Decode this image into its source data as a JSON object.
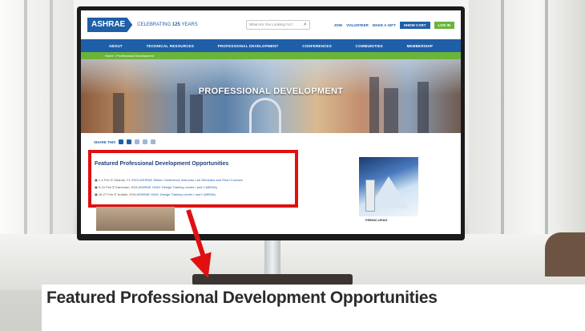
{
  "header": {
    "logo_text": "ASHRAE",
    "celebrating_prefix": "CELEBRATING",
    "celebrating_number": "125",
    "celebrating_suffix": "YEARS",
    "search_placeholder": "What Are You Looking For?",
    "links": [
      "JOIN",
      "VOLUNTEER",
      "MAKE A GIFT"
    ],
    "cart_label": "SHOW CART",
    "login_label": "LOG IN"
  },
  "nav": {
    "items": [
      "ABOUT",
      "TECHNICAL RESOURCES",
      "PROFESSIONAL DEVELOPMENT",
      "CONFERENCES",
      "COMMUNITIES",
      "MEMBERSHIP"
    ]
  },
  "breadcrumb": {
    "home": "Home",
    "current": "Professional Development"
  },
  "banner": {
    "title": "PROFESSIONAL DEVELOPMENT"
  },
  "share": {
    "label": "SHARE THIS"
  },
  "featured": {
    "title": "Featured Professional Development Opportunities",
    "events": [
      {
        "date": "1-4 Feb",
        "location": "Orlando, FL",
        "link": "2020 ASHRAE Winter Conference Instructor Led Seminars and Short Courses"
      },
      {
        "date": "9-10 Feb",
        "location": "Dammam, KSA",
        "link": "ASHRAE HVAC Design Training Levels I and II (MENA)"
      },
      {
        "date": "26-27 Feb",
        "location": "Jeddah, KSA",
        "link": "ASHRAE HVAC Design Training Levels I and II (MENA)"
      }
    ]
  },
  "ad": {
    "caption": "FRENIC-HPAG"
  },
  "zoom": {
    "title": "Featured Professional Development Opportunities"
  },
  "colors": {
    "brand_blue": "#1f5fa8",
    "brand_green": "#6bb43a",
    "highlight_red": "#e01010"
  }
}
